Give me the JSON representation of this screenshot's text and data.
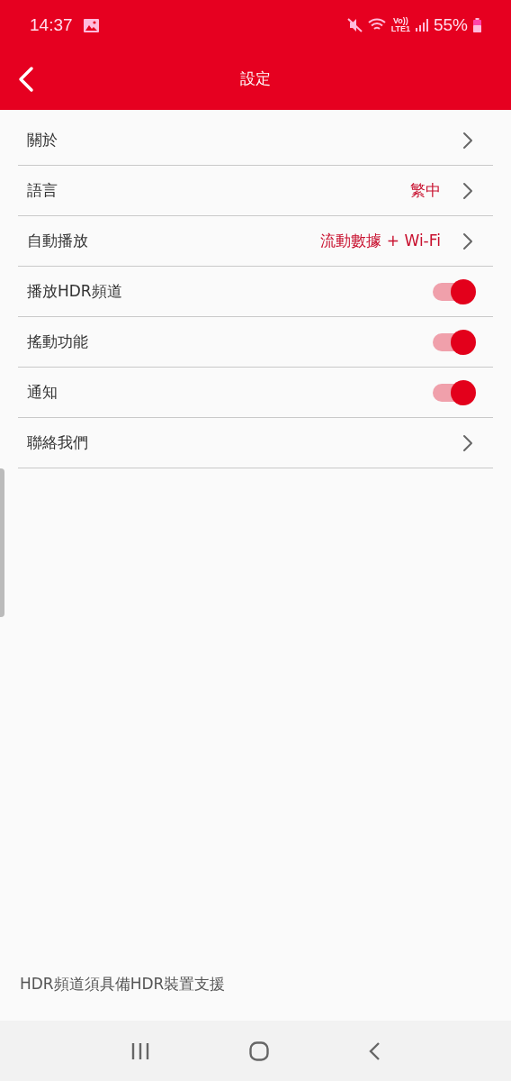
{
  "status_bar": {
    "time": "14:37",
    "network": "Vo))\nLTE1",
    "battery": "55%"
  },
  "header": {
    "title": "設定"
  },
  "rows": [
    {
      "kind": "link",
      "label": "關於"
    },
    {
      "kind": "link",
      "label": "語言",
      "value": "繁中"
    },
    {
      "kind": "link",
      "label": "自動播放",
      "value": "流動數據 + Wi-Fi"
    },
    {
      "kind": "toggle",
      "label": "播放HDR頻道",
      "on": true
    },
    {
      "kind": "toggle",
      "label": "搖動功能",
      "on": true
    },
    {
      "kind": "toggle",
      "label": "通知",
      "on": true
    },
    {
      "kind": "link",
      "label": "聯絡我們"
    }
  ],
  "footnote": "HDR頻道須具備HDR裝置支援"
}
